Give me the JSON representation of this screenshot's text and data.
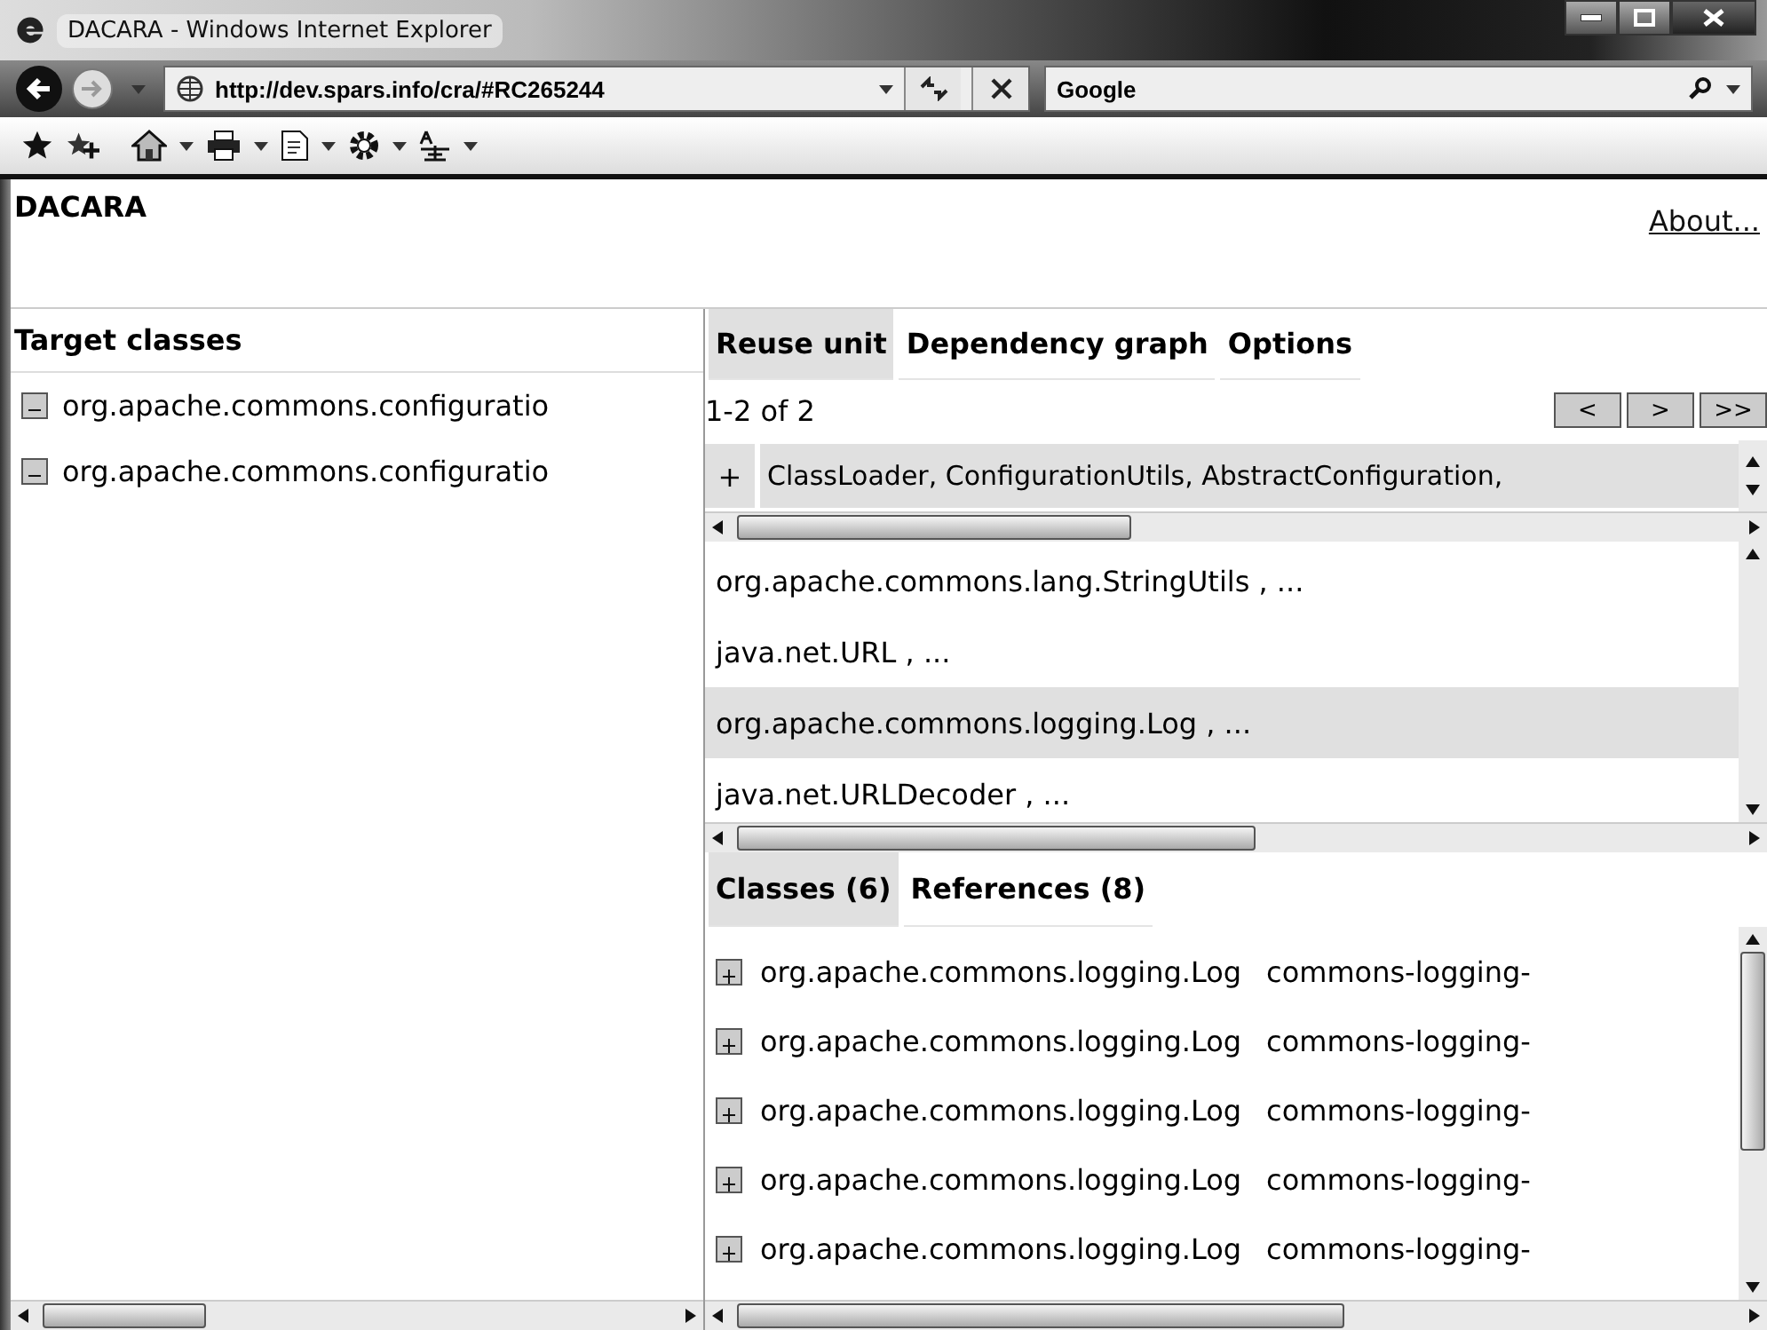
{
  "window": {
    "title": "DACARA - Windows Internet Explorer"
  },
  "address_bar": {
    "url": "http://dev.spars.info/cra/#RC265244"
  },
  "search": {
    "value": "Google"
  },
  "page_header": {
    "title": "DACARA",
    "link": "About..."
  },
  "target_classes": {
    "title": "Target classes",
    "items": [
      {
        "label": "org.apache.commons.configuratio",
        "expanded": true
      },
      {
        "label": "org.apache.commons.configuratio",
        "expanded": true
      }
    ]
  },
  "tabs": [
    {
      "label": "Reuse unit",
      "selected": true
    },
    {
      "label": "Dependency graph",
      "selected": false
    },
    {
      "label": "Options",
      "selected": false
    }
  ],
  "pager": {
    "range": "1-2 of 2",
    "buttons": [
      "<",
      ">",
      ">>"
    ]
  },
  "unit_row": {
    "toggle": "+",
    "label": "ClassLoader, ConfigurationUtils, AbstractConfiguration,"
  },
  "dependencies": [
    {
      "label": "org.apache.commons.lang.StringUtils , ...",
      "selected": false
    },
    {
      "label": "java.net.URL , ...",
      "selected": false
    },
    {
      "label": "org.apache.commons.logging.Log , ...",
      "selected": true
    },
    {
      "label": "java.net.URLDecoder , ...",
      "selected": false
    }
  ],
  "detail_tabs": [
    {
      "label": "Classes (6)",
      "selected": true
    },
    {
      "label": "References (8)",
      "selected": false
    }
  ],
  "classes": [
    {
      "name": "org.apache.commons.logging.Log",
      "jar": "commons-logging-",
      "expanded": false
    },
    {
      "name": "org.apache.commons.logging.Log",
      "jar": "commons-logging-",
      "expanded": false
    },
    {
      "name": "org.apache.commons.logging.Log",
      "jar": "commons-logging-",
      "expanded": false
    },
    {
      "name": "org.apache.commons.logging.Log",
      "jar": "commons-logging-",
      "expanded": false
    },
    {
      "name": "org.apache.commons.logging.Log",
      "jar": "commons-logging-",
      "expanded": false
    }
  ]
}
